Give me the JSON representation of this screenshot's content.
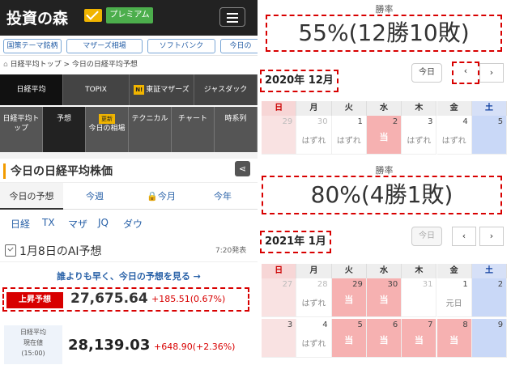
{
  "site": {
    "logo": "投資の森",
    "premium_label": "プレミアム"
  },
  "tags": [
    "国策テーマ銘柄",
    "マザーズ相場",
    "ソフトバンク",
    "今日の"
  ],
  "breadcrumb": {
    "home": "日経平均トップ",
    "sep": ">",
    "current": "今日の日経平均予想"
  },
  "nav_main": [
    {
      "label": "日経平均",
      "active": true
    },
    {
      "label": "TOPIX",
      "active": false
    },
    {
      "badge": "N!",
      "label": "東証マザーズ",
      "active": false
    },
    {
      "label": "ジャスダック",
      "active": false
    }
  ],
  "nav_sub": [
    {
      "label": "日経平均トップ",
      "active": false
    },
    {
      "label": "予想",
      "active": true
    },
    {
      "badge": "更新",
      "label": "今日の相場",
      "active": false
    },
    {
      "label": "テクニカル",
      "active": false
    },
    {
      "label": "チャート",
      "active": false
    },
    {
      "label": "時系列",
      "active": false
    }
  ],
  "section_title": "今日の日経平均株価",
  "tabs": [
    {
      "label": "今日の予想",
      "active": true
    },
    {
      "label": "今週",
      "active": false
    },
    {
      "label": "今月",
      "active": false,
      "locked": true
    },
    {
      "label": "今年",
      "active": false
    }
  ],
  "markets": [
    "日経",
    "TX",
    "マザ",
    "JQ",
    "ダウ"
  ],
  "ai": {
    "title": "1月8日のAI予想",
    "time": "7:20発表"
  },
  "cta": "誰よりも早く、今日の予想を見る →",
  "forecast": {
    "badge": "上昇予想",
    "value": "27,675.64",
    "change": "+185.51(0.67%)"
  },
  "actual": {
    "label1": "日経平均",
    "label2": "現在値",
    "label3": "(15:00)",
    "value": "28,139.03",
    "change": "+648.90(+2.36%)"
  },
  "weekdays": [
    "日",
    "月",
    "火",
    "水",
    "木",
    "金",
    "土"
  ],
  "cal1": {
    "rate_label": "勝率",
    "rate": "55%(12勝10敗)",
    "month": "2020年 12月",
    "today": "今日",
    "prev": "‹",
    "next": "›",
    "cells": [
      {
        "d": "29",
        "l": "",
        "t": "sun-dim"
      },
      {
        "d": "30",
        "l": "はずれ",
        "t": "dim"
      },
      {
        "d": "1",
        "l": "はずれ",
        "t": ""
      },
      {
        "d": "2",
        "l": "当",
        "t": "win"
      },
      {
        "d": "3",
        "l": "はずれ",
        "t": ""
      },
      {
        "d": "4",
        "l": "はずれ",
        "t": ""
      },
      {
        "d": "5",
        "l": "",
        "t": "sat"
      }
    ]
  },
  "cal2": {
    "rate_label": "勝率",
    "rate": "80%(4勝1敗)",
    "month": "2021年 1月",
    "today": "今日",
    "prev": "‹",
    "next": "›",
    "cells": [
      {
        "d": "27",
        "l": "",
        "t": "sun-dim"
      },
      {
        "d": "28",
        "l": "はずれ",
        "t": "dim"
      },
      {
        "d": "29",
        "l": "当",
        "t": "win"
      },
      {
        "d": "30",
        "l": "当",
        "t": "win"
      },
      {
        "d": "31",
        "l": "",
        "t": "dim"
      },
      {
        "d": "1",
        "l": "元日",
        "t": ""
      },
      {
        "d": "2",
        "l": "",
        "t": "sat"
      },
      {
        "d": "3",
        "l": "",
        "t": "sun"
      },
      {
        "d": "4",
        "l": "はずれ",
        "t": ""
      },
      {
        "d": "5",
        "l": "当",
        "t": "win"
      },
      {
        "d": "6",
        "l": "当",
        "t": "win"
      },
      {
        "d": "7",
        "l": "当",
        "t": "win"
      },
      {
        "d": "8",
        "l": "当",
        "t": "win"
      },
      {
        "d": "9",
        "l": "",
        "t": "sat"
      }
    ]
  }
}
